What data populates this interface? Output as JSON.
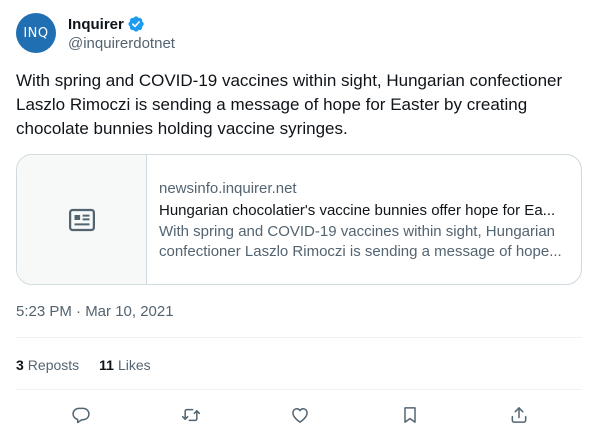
{
  "author": {
    "avatar_text": "INQ",
    "display_name": "Inquirer",
    "handle": "@inquirerdotnet",
    "verified": true
  },
  "tweet": {
    "text": "With spring and COVID-19 vaccines within sight, Hungarian confectioner Laszlo Rimoczi is sending a message of hope for Easter by creating chocolate bunnies holding vaccine syringes."
  },
  "card": {
    "domain": "newsinfo.inquirer.net",
    "title": "Hungarian chocolatier's vaccine bunnies offer hope for Ea...",
    "description": "With spring and COVID-19 vaccines within sight, Hungarian confectioner Laszlo Rimoczi is sending a message of hope..."
  },
  "timestamp": "5:23 PM · Mar 10, 2021",
  "stats": {
    "reposts_count": "3",
    "reposts_label": "Reposts",
    "likes_count": "11",
    "likes_label": "Likes"
  },
  "icons": {
    "reply": "reply-icon",
    "repost": "repost-icon",
    "like": "heart-icon",
    "bookmark": "bookmark-icon",
    "share": "share-icon",
    "article": "article-icon",
    "verified": "verified-badge-icon"
  },
  "colors": {
    "avatar_bg": "#1f6fb2",
    "verified": "#1d9bf0",
    "secondary_text": "#536471",
    "border": "#cfd9de"
  }
}
